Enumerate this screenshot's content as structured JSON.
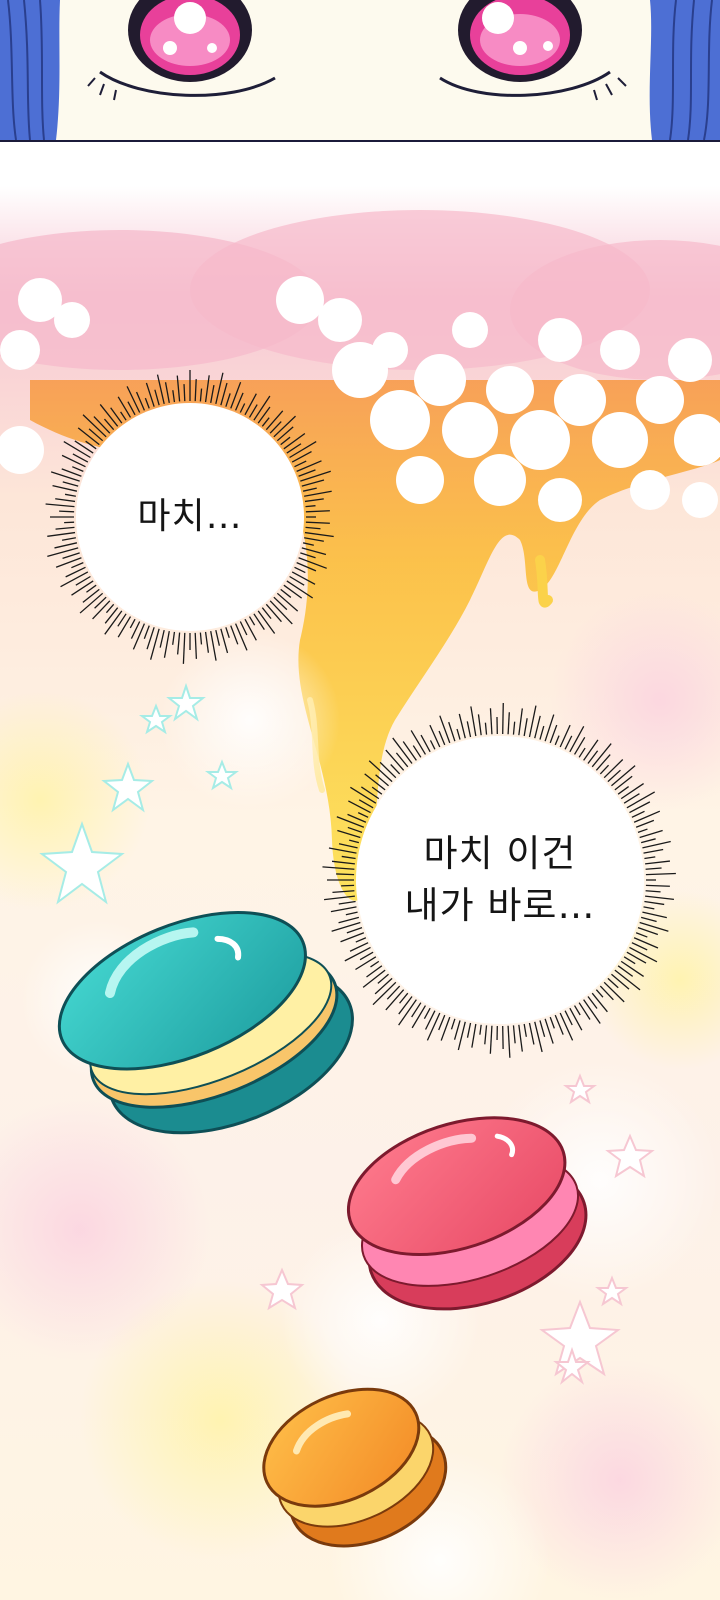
{
  "panels": [
    {
      "id": "eyes-closeup"
    },
    {
      "id": "macaron-fantasy"
    }
  ],
  "speech_bubbles": [
    {
      "lines": [
        "마치…"
      ]
    },
    {
      "lines": [
        "마치 이건",
        "내가 바로…"
      ]
    }
  ],
  "colors": {
    "background_pink": "#f6c6d2",
    "honey": "#f9cf2e",
    "macaron_teal": "#3ccfc8",
    "macaron_pink": "#f6617a",
    "macaron_orange": "#f9a63a",
    "eye_pink": "#e8409a",
    "hair_blue": "#4a6ed6"
  }
}
